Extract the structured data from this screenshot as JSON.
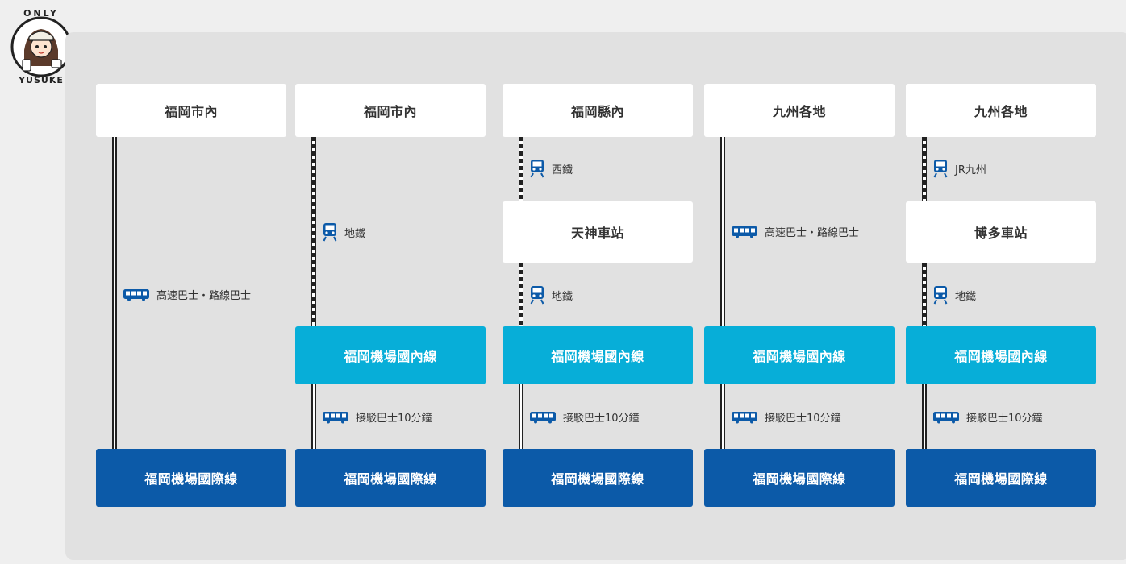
{
  "logo": {
    "top_text": "ONLY",
    "bottom_text": "YUSUKE"
  },
  "colors": {
    "domestic": "#07aed8",
    "international": "#0c5aa8",
    "origin_box": "#ffffff",
    "panel": "#e1e1e1"
  },
  "routes": [
    {
      "origin": "福岡市內",
      "legs": [
        {
          "icon": "bus-icon",
          "label": "高速巴士・路線巴士"
        }
      ],
      "international": "福岡機場國際線"
    },
    {
      "origin": "福岡市內",
      "legs": [
        {
          "icon": "train-icon",
          "label": "地鐵"
        }
      ],
      "domestic": "福岡機場國內線",
      "shuttle": {
        "icon": "bus-icon",
        "label": "接駁巴士10分鐘"
      },
      "international": "福岡機場國際線"
    },
    {
      "origin": "福岡縣內",
      "legs": [
        {
          "icon": "train-icon",
          "label": "西鐵"
        },
        {
          "icon": "train-icon",
          "label": "地鐵"
        }
      ],
      "station": "天神車站",
      "domestic": "福岡機場國內線",
      "shuttle": {
        "icon": "bus-icon",
        "label": "接駁巴士10分鐘"
      },
      "international": "福岡機場國際線"
    },
    {
      "origin": "九州各地",
      "legs": [
        {
          "icon": "bus-icon",
          "label": "高速巴士・路線巴士"
        }
      ],
      "domestic": "福岡機場國內線",
      "shuttle": {
        "icon": "bus-icon",
        "label": "接駁巴士10分鐘"
      },
      "international": "福岡機場國際線"
    },
    {
      "origin": "九州各地",
      "legs": [
        {
          "icon": "train-icon",
          "label": "JR九州"
        },
        {
          "icon": "train-icon",
          "label": "地鐵"
        }
      ],
      "station": "博多車站",
      "domestic": "福岡機場國內線",
      "shuttle": {
        "icon": "bus-icon",
        "label": "接駁巴士10分鐘"
      },
      "international": "福岡機場國際線"
    }
  ]
}
